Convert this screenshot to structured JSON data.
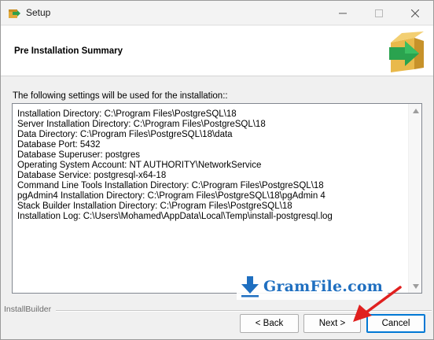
{
  "window": {
    "title": "Setup",
    "icons": {
      "app": "installer-box-icon",
      "minimize": "minimize-icon",
      "maximize": "maximize-icon",
      "close": "close-icon"
    }
  },
  "header": {
    "title": "Pre Installation Summary",
    "logo_icon": "package-arrow-icon"
  },
  "intro_text": "The following settings will be used for the installation::",
  "settings": [
    "Installation Directory: C:\\Program Files\\PostgreSQL\\18",
    "Server Installation Directory: C:\\Program Files\\PostgreSQL\\18",
    "Data Directory: C:\\Program Files\\PostgreSQL\\18\\data",
    "Database Port: 5432",
    "Database Superuser: postgres",
    "Operating System Account: NT AUTHORITY\\NetworkService",
    "Database Service: postgresql-x64-18",
    "Command Line Tools Installation Directory: C:\\Program Files\\PostgreSQL\\18",
    "pgAdmin4 Installation Directory: C:\\Program Files\\PostgreSQL\\18\\pgAdmin 4",
    "Stack Builder Installation Directory: C:\\Program Files\\PostgreSQL\\18",
    "Installation Log: C:\\Users\\Mohamed\\AppData\\Local\\Temp\\install-postgresql.log"
  ],
  "watermark": {
    "text": "GramFile.com",
    "icon": "download-arrow-icon"
  },
  "footer": {
    "brand": "InstallBuilder",
    "back_label": "< Back",
    "next_label": "Next >",
    "cancel_label": "Cancel"
  },
  "colors": {
    "accent": "#0078d4",
    "watermark": "#1f6fc0",
    "arrow": "#e0201f",
    "logo_box": "#e7b84a",
    "logo_arrow": "#27a34f"
  }
}
